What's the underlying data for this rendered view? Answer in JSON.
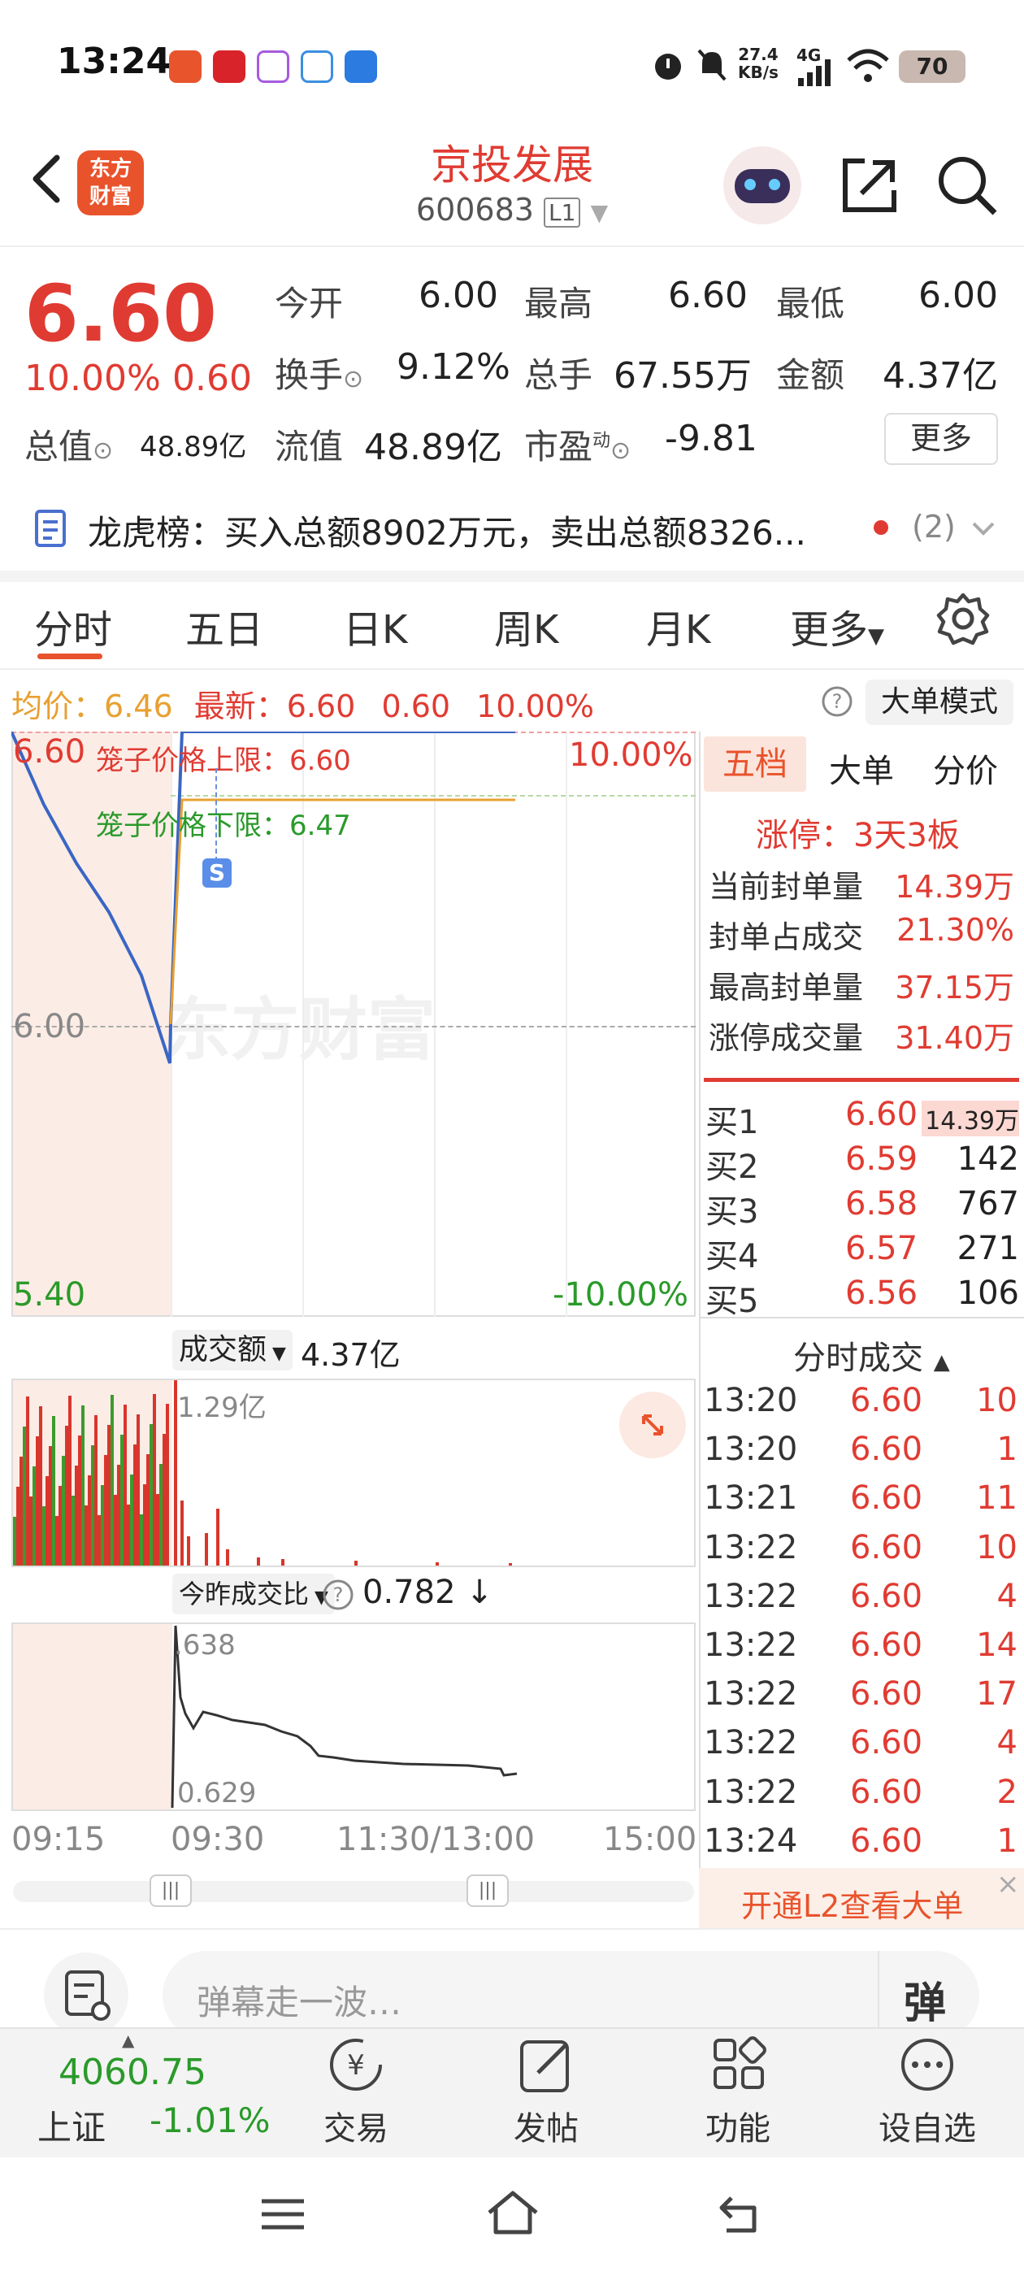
{
  "status_bar": {
    "time": "13:24",
    "net_speed_value": "27.4",
    "net_speed_unit": "KB/s",
    "network": "4G",
    "battery": "70"
  },
  "header": {
    "app_logo_line1": "东方",
    "app_logo_line2": "财富",
    "title": "京投发展",
    "code": "600683",
    "level": "L1"
  },
  "quote": {
    "price": "6.60",
    "change_pct": "10.00%",
    "change": "0.60",
    "open_label": "今开",
    "open": "6.00",
    "high_label": "最高",
    "high": "6.60",
    "low_label": "最低",
    "low": "6.00",
    "turnover_rate_label": "换手",
    "turnover_rate": "9.12%",
    "volume_label": "总手",
    "volume": "67.55万",
    "amount_label": "金额",
    "amount": "4.37亿",
    "total_mv_label": "总值",
    "total_mv": "48.89亿",
    "float_mv_label": "流值",
    "float_mv": "48.89亿",
    "pe_label": "市盈",
    "pe_sup": "动",
    "pe": "-9.81",
    "more_label": "更多"
  },
  "dragon_tiger": {
    "text": "龙虎榜：买入总额8902万元，卖出总额8326...",
    "count": "(2)"
  },
  "tabs": [
    "分时",
    "五日",
    "日K",
    "周K",
    "月K",
    "更多"
  ],
  "info_line": {
    "avg_label": "均价：",
    "avg": "6.46",
    "latest_label": "最新：",
    "latest": "6.60",
    "chg": "0.60",
    "pct": "10.00%",
    "mode_button": "大单模式"
  },
  "chart": {
    "price_top": "6.60",
    "price_mid": "6.00",
    "price_bottom": "5.40",
    "pct_top": "10.00%",
    "pct_bottom": "-10.00%",
    "cage_upper": "笼子价格上限：6.60",
    "cage_lower": "笼子价格下限：6.47",
    "s_marker": "S",
    "watermark": "东方财富",
    "volume_label": "成交额",
    "volume_total": "4.37亿",
    "volume_max": "1.29亿",
    "ratio_label": "今昨成交比",
    "ratio_value": "0.782",
    "ratio_arrow": "↓",
    "ratio_top": ".638",
    "ratio_bottom": "0.629",
    "times": [
      "09:15",
      "09:30",
      "11:30/13:00",
      "15:00"
    ]
  },
  "chart_data": {
    "type": "line",
    "title": "",
    "xlabel": "",
    "ylabel": "",
    "ylim": [
      5.4,
      6.6
    ],
    "x": [
      "09:15",
      "09:17",
      "09:19",
      "09:21",
      "09:23",
      "09:25",
      "09:30",
      "09:31",
      "10:00",
      "11:30"
    ],
    "series": [
      {
        "name": "",
        "values": [
          6.6,
          6.45,
          6.33,
          6.23,
          6.1,
          5.92,
          6.0,
          6.6,
          6.6,
          6.6
        ]
      },
      {
        "name": "均价",
        "values": [
          null,
          null,
          null,
          null,
          null,
          null,
          6.0,
          6.46,
          6.46,
          6.46
        ]
      }
    ]
  },
  "order_book": {
    "tabs": [
      "五档",
      "大单",
      "分价"
    ],
    "limit_status": "涨停：3天3板",
    "stats": [
      {
        "label": "当前封单量",
        "value": "14.39万"
      },
      {
        "label": "封单占成交",
        "value": "21.30%"
      },
      {
        "label": "最高封单量",
        "value": "37.15万"
      },
      {
        "label": "涨停成交量",
        "value": "31.40万"
      }
    ],
    "bids": [
      {
        "label": "买1",
        "price": "6.60",
        "vol": "14.39万"
      },
      {
        "label": "买2",
        "price": "6.59",
        "vol": "142"
      },
      {
        "label": "买3",
        "price": "6.58",
        "vol": "767"
      },
      {
        "label": "买4",
        "price": "6.57",
        "vol": "271"
      },
      {
        "label": "买5",
        "price": "6.56",
        "vol": "106"
      }
    ],
    "ticks_title": "分时成交",
    "ticks": [
      {
        "time": "13:20",
        "price": "6.60",
        "vol": "10"
      },
      {
        "time": "13:20",
        "price": "6.60",
        "vol": "1"
      },
      {
        "time": "13:21",
        "price": "6.60",
        "vol": "11"
      },
      {
        "time": "13:22",
        "price": "6.60",
        "vol": "10"
      },
      {
        "time": "13:22",
        "price": "6.60",
        "vol": "4"
      },
      {
        "time": "13:22",
        "price": "6.60",
        "vol": "14"
      },
      {
        "time": "13:22",
        "price": "6.60",
        "vol": "17"
      },
      {
        "time": "13:22",
        "price": "6.60",
        "vol": "4"
      },
      {
        "time": "13:22",
        "price": "6.60",
        "vol": "2"
      },
      {
        "time": "13:24",
        "price": "6.60",
        "vol": "1"
      }
    ],
    "l2_banner": "开通L2查看大单"
  },
  "comment": {
    "placeholder": "弹幕走一波…",
    "danmu_button": "弹"
  },
  "bottom_nav": {
    "index_value": "4060.75",
    "index_name": "上证",
    "index_change": "-1.01%",
    "items": [
      "交易",
      "发帖",
      "功能",
      "设自选"
    ],
    "trade_glyph": "¥"
  }
}
